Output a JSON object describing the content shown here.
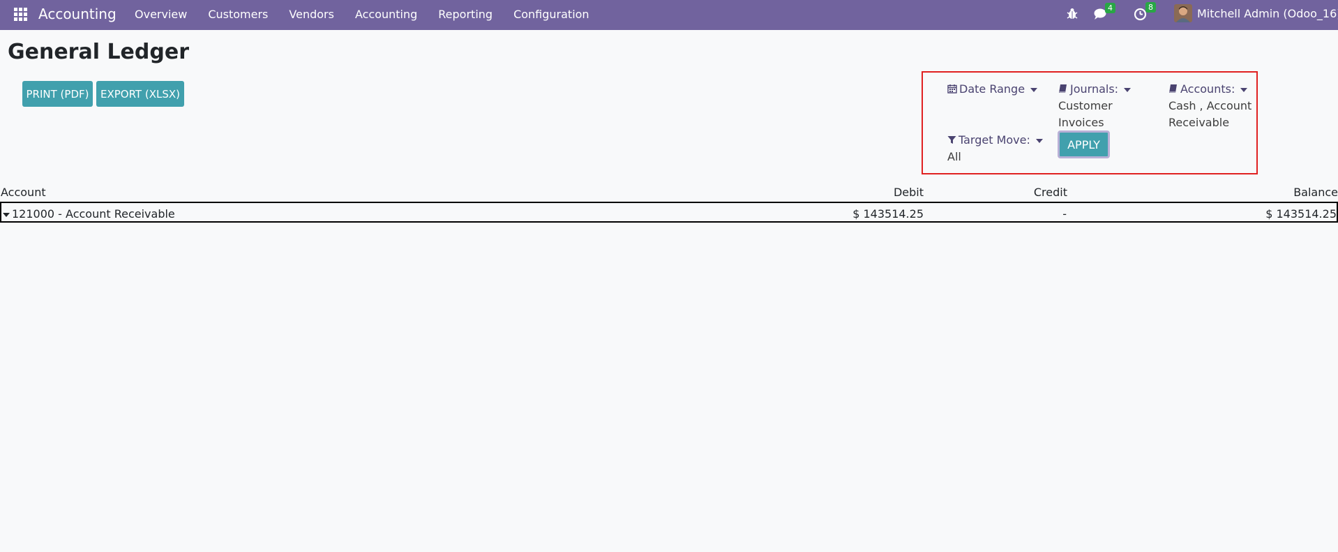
{
  "navbar": {
    "app_name": "Accounting",
    "menu": [
      "Overview",
      "Customers",
      "Vendors",
      "Accounting",
      "Reporting",
      "Configuration"
    ],
    "messages_count": "4",
    "activities_count": "8",
    "user_name": "Mitchell Admin (Odoo_16)",
    "bg_color": "#71639e"
  },
  "page": {
    "title": "General Ledger",
    "print_label": "PRINT (PDF)",
    "export_label": "EXPORT (XLSX)"
  },
  "filters": {
    "date_range_label": "Date Range",
    "journals_label": "Journals:",
    "journals_value_line1": "Customer",
    "journals_value_line2": "Invoices",
    "accounts_label": "Accounts:",
    "accounts_value_line1": "Cash , Account",
    "accounts_value_line2": "Receivable",
    "target_move_label": "Target Move:",
    "target_move_value": "All",
    "apply_label": "APPLY"
  },
  "table": {
    "headers": {
      "account": "Account",
      "debit": "Debit",
      "credit": "Credit",
      "balance": "Balance"
    },
    "rows": [
      {
        "account": "121000 - Account Receivable",
        "debit": "$ 143514.25",
        "credit": "-",
        "balance": "$ 143514.25"
      }
    ]
  },
  "colors": {
    "accent": "#41a0ad",
    "highlight_border": "#e02020"
  }
}
